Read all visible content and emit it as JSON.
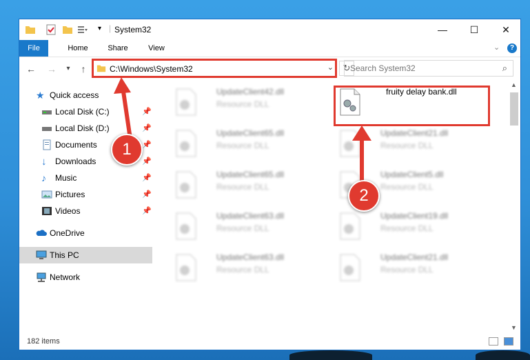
{
  "window": {
    "title": "System32",
    "controls": {
      "minimize": "—",
      "maximize": "☐",
      "close": "✕"
    }
  },
  "ribbon": {
    "tabs": [
      "File",
      "Home",
      "Share",
      "View"
    ],
    "help": "?"
  },
  "nav": {
    "address": "C:\\Windows\\System32",
    "search_placeholder": "Search System32"
  },
  "sidebar": {
    "items": [
      {
        "label": "Quick access",
        "icon": "star-icon"
      },
      {
        "label": "Local Disk (C:)",
        "icon": "drive-icon",
        "pinned": true
      },
      {
        "label": "Local Disk (D:)",
        "icon": "drive-icon",
        "pinned": true
      },
      {
        "label": "Documents",
        "icon": "documents-icon",
        "pinned": true
      },
      {
        "label": "Downloads",
        "icon": "download-icon",
        "pinned": true
      },
      {
        "label": "Music",
        "icon": "music-icon",
        "pinned": true
      },
      {
        "label": "Pictures",
        "icon": "pictures-icon",
        "pinned": true
      },
      {
        "label": "Videos",
        "icon": "videos-icon",
        "pinned": true
      },
      {
        "label": "OneDrive",
        "icon": "cloud-icon"
      },
      {
        "label": "This PC",
        "icon": "computer-icon",
        "selected": true
      },
      {
        "label": "Network",
        "icon": "network-icon"
      }
    ]
  },
  "files": {
    "left": [
      {
        "name": "UpdateClient42.dll",
        "type": "Resource DLL"
      },
      {
        "name": "UpdateClient65.dll",
        "type": "Resource DLL"
      },
      {
        "name": "UpdateClient65.dll",
        "type": "Resource DLL"
      },
      {
        "name": "UpdateClient63.dll",
        "type": "Resource DLL"
      },
      {
        "name": "UpdateClient63.dll",
        "type": "Resource DLL"
      }
    ],
    "right": [
      {
        "name": "fruity delay bank.dll",
        "type": "",
        "highlighted": true
      },
      {
        "name": "UpdateClient21.dll",
        "type": "Resource DLL"
      },
      {
        "name": "UpdateClient5.dll",
        "type": "Resource DLL"
      },
      {
        "name": "UpdateClient19.dll",
        "type": "Resource DLL"
      },
      {
        "name": "UpdateClient21.dll",
        "type": "Resource DLL"
      }
    ]
  },
  "status": {
    "item_count": "182 items"
  },
  "callouts": [
    "1",
    "2"
  ],
  "colors": {
    "accent": "#1979ca",
    "highlight": "#e03a2f",
    "selection": "#d9d9d9"
  }
}
